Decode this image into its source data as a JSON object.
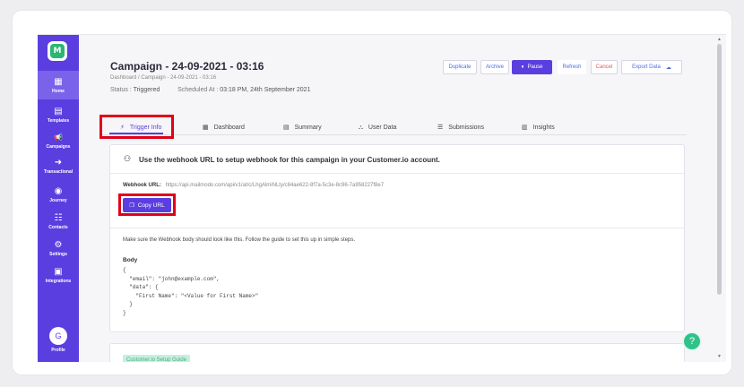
{
  "sidebar": {
    "items": [
      {
        "label": "Home",
        "icon": "grid-icon",
        "glyph": "▦"
      },
      {
        "label": "Templates",
        "icon": "template-icon",
        "glyph": "▤"
      },
      {
        "label": "Campaigns",
        "icon": "megaphone-icon",
        "glyph": "📢"
      },
      {
        "label": "Transactional",
        "icon": "arrow-circle-icon",
        "glyph": "➜"
      },
      {
        "label": "Journey",
        "icon": "journey-icon",
        "glyph": "◉"
      },
      {
        "label": "Contacts",
        "icon": "contacts-icon",
        "glyph": "☷"
      },
      {
        "label": "Settings",
        "icon": "gear-icon",
        "glyph": "⚙"
      },
      {
        "label": "Integrations",
        "icon": "integrations-icon",
        "glyph": "▣"
      }
    ],
    "profile": {
      "initial": "G",
      "label": "Profile"
    }
  },
  "header": {
    "title": "Campaign - 24-09-2021 - 03:16",
    "breadcrumb": "Dashboard  /  Campaign - 24-09-2021 - 03:16",
    "status_label": "Status :",
    "status_value": "Triggered",
    "scheduled_label": "Scheduled At :",
    "scheduled_value": "03:18 PM, 24th September 2021"
  },
  "toolbar": {
    "duplicate": "Duplicate",
    "archive": "Archive",
    "pause": "Pause",
    "refresh": "Refresh",
    "cancel": "Cancel",
    "export": "Export Data"
  },
  "tabs": [
    {
      "label": "Trigger Info",
      "glyph": "⚡"
    },
    {
      "label": "Dashboard",
      "glyph": "▦"
    },
    {
      "label": "Summary",
      "glyph": "▤"
    },
    {
      "label": "User Data",
      "glyph": "⛬"
    },
    {
      "label": "Submissions",
      "glyph": "☰"
    },
    {
      "label": "Insights",
      "glyph": "▥"
    }
  ],
  "webhook_card": {
    "heading": "Use the webhook URL to setup webhook for this campaign in your Customer.io account.",
    "url_label": "Webhook URL:",
    "url_value": "https://api.mailmodo.com/api/v1/at/c/LhgAlmiNLty/c84ae622-8f7a-5c3e-8c96-7a958227f8e7",
    "copy_label": "Copy URL",
    "note": "Make sure the Webhook body should look like this. Follow the guide to set this up in simple steps.",
    "body_label": "Body",
    "code": "{\n  \"email\": \"john@example.com\",\n  \"data\": {\n    \"First Name\": \"<Value for First Name>\"\n  }\n}"
  },
  "guide_card": {
    "badge": "Customer.io Setup Guide"
  },
  "help": {
    "glyph": "?"
  }
}
